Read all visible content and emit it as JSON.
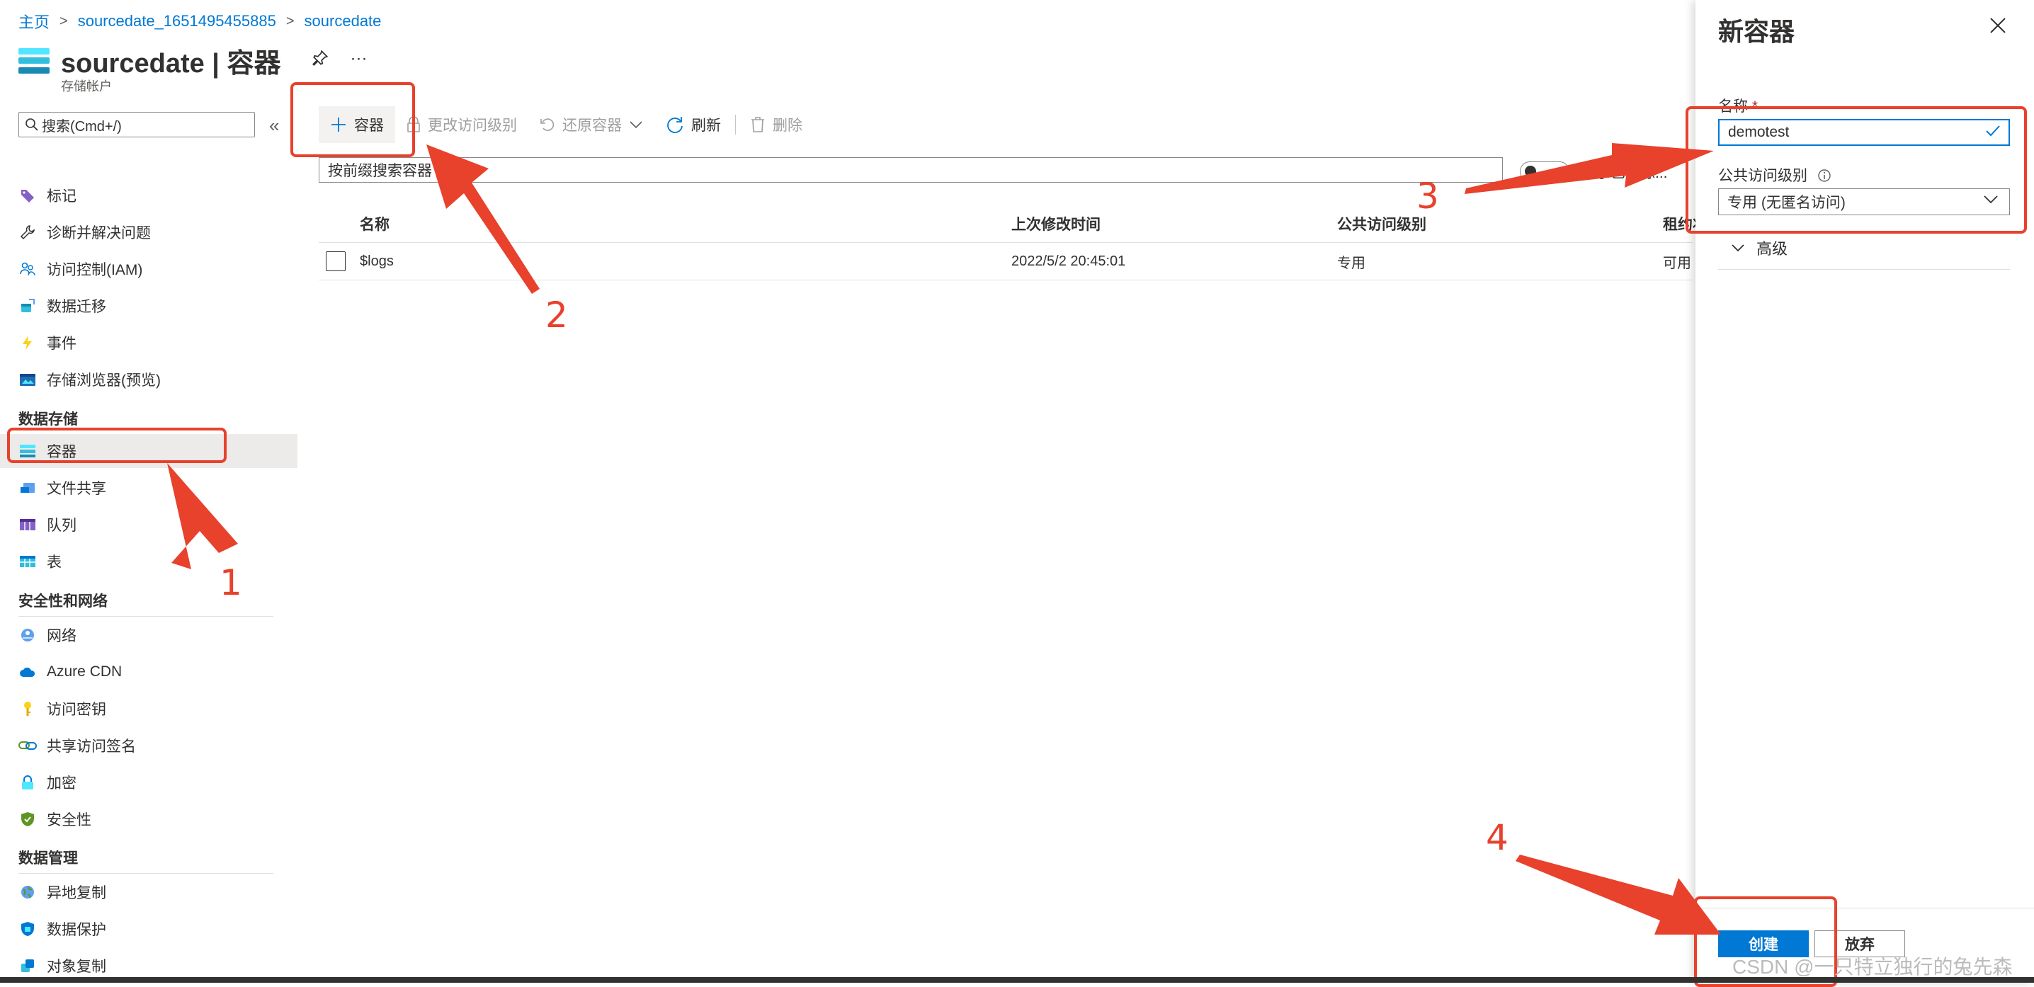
{
  "breadcrumb": {
    "home": "主页",
    "account_link": "sourcedate_1651495455885",
    "current": "sourcedate",
    "separator": ">"
  },
  "header": {
    "title": "sourcedate | 容器",
    "subtitle": "存储帐户",
    "more": "···"
  },
  "sidebar": {
    "search_placeholder": "搜索(Cmd+/)",
    "collapse": "«",
    "items": [
      {
        "label": "标记",
        "icon": "tag-icon"
      },
      {
        "label": "诊断并解决问题",
        "icon": "wrench-icon"
      },
      {
        "label": "访问控制(IAM)",
        "icon": "people-icon"
      },
      {
        "label": "数据迁移",
        "icon": "migration-icon"
      },
      {
        "label": "事件",
        "icon": "lightning-icon"
      },
      {
        "label": "存储浏览器(预览)",
        "icon": "explorer-icon"
      }
    ],
    "section_data_storage": "数据存储",
    "data_storage_items": [
      {
        "label": "容器",
        "icon": "container-icon"
      },
      {
        "label": "文件共享",
        "icon": "file-share-icon"
      },
      {
        "label": "队列",
        "icon": "queue-icon"
      },
      {
        "label": "表",
        "icon": "table-icon"
      }
    ],
    "section_security": "安全性和网络",
    "security_items": [
      {
        "label": "网络",
        "icon": "network-icon"
      },
      {
        "label": "Azure CDN",
        "icon": "cloud-icon"
      },
      {
        "label": "访问密钥",
        "icon": "key-icon"
      },
      {
        "label": "共享访问签名",
        "icon": "link-icon"
      },
      {
        "label": "加密",
        "icon": "lock-icon"
      },
      {
        "label": "安全性",
        "icon": "shield-icon"
      }
    ],
    "section_data_management": "数据管理",
    "data_management_items": [
      {
        "label": "异地复制",
        "icon": "globe-icon"
      },
      {
        "label": "数据保护",
        "icon": "data-protection-icon"
      },
      {
        "label": "对象复制",
        "icon": "replication-icon"
      }
    ]
  },
  "toolbar": {
    "add_container": "容器",
    "change_access": "更改访问级别",
    "restore": "还原容器",
    "refresh": "刷新",
    "delete": "删除"
  },
  "filter": {
    "placeholder": "按前缀搜索容器",
    "toggle_label": "显示已删除..."
  },
  "table": {
    "headers": [
      "名称",
      "上次修改时间",
      "公共访问级别",
      "租约状态"
    ],
    "rows": [
      {
        "name": "$logs",
        "modified": "2022/5/2 20:45:01",
        "access": "专用",
        "lease": "可用"
      }
    ]
  },
  "panel": {
    "title": "新容器",
    "name_label": "名称",
    "required_mark": "*",
    "name_value": "demotest",
    "access_label": "公共访问级别",
    "access_value": "专用 (无匿名访问)",
    "advanced": "高级",
    "create": "创建",
    "discard": "放弃"
  },
  "annotations": {
    "steps": [
      "1",
      "2",
      "3",
      "4"
    ],
    "color": "#e8412c",
    "watermark": "CSDN @一只特立独行的兔先森"
  },
  "colors": {
    "accent": "#0078d4",
    "active_bg": "#edebe9",
    "text": "#323130"
  }
}
